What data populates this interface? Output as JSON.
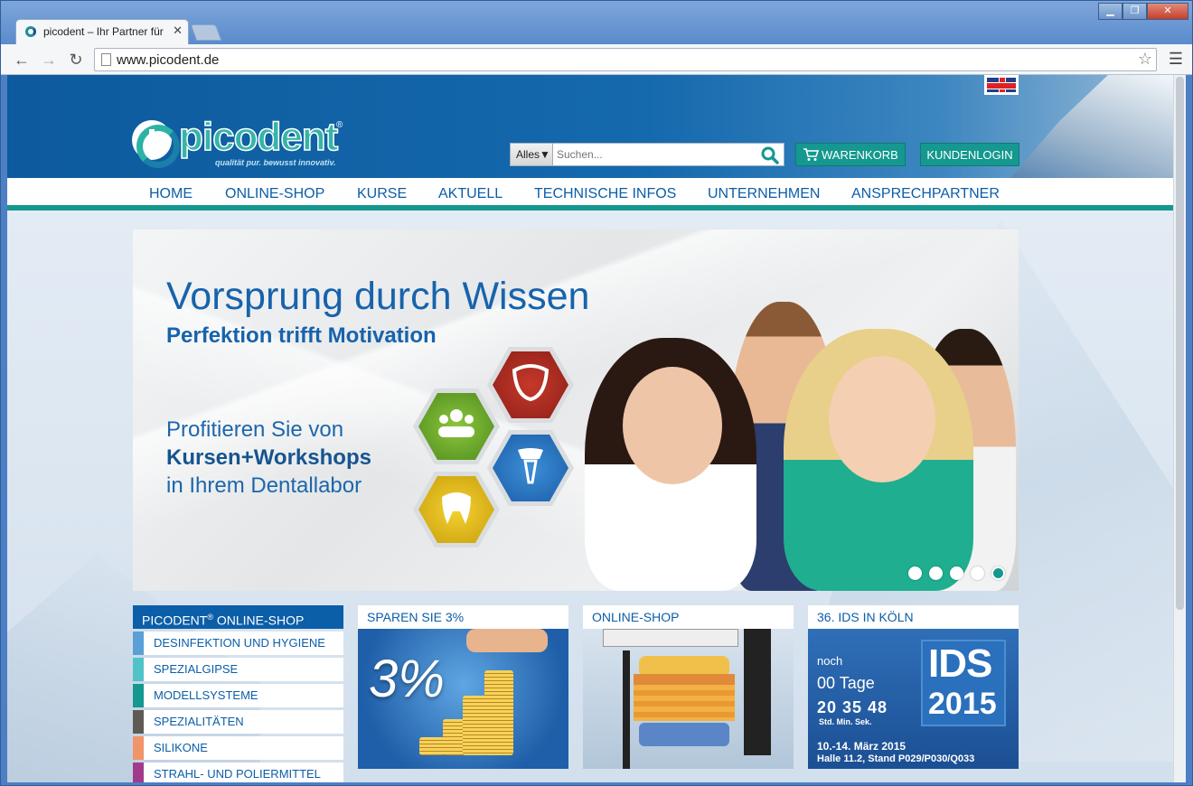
{
  "browser": {
    "tab_title": "picodent – Ihr Partner für",
    "url": "www.picodent.de",
    "minimize": "▁",
    "restore": "❐",
    "close": "✕"
  },
  "header": {
    "logo_text": "picodent",
    "logo_tagline": "qualität pur. bewusst innovativ.",
    "search_scope": "Alles▼",
    "search_placeholder": "Suchen...",
    "cart_label": "WARENKORB",
    "login_label": "KUNDENLOGIN",
    "language_flag": "uk-flag-icon"
  },
  "nav": {
    "items": [
      "HOME",
      "ONLINE-SHOP",
      "KURSE",
      "AKTUELL",
      "TECHNISCHE INFOS",
      "UNTERNEHMEN",
      "ANSPRECHPARTNER"
    ]
  },
  "slider": {
    "headline": "Vorsprung durch Wissen",
    "subheadline": "Perfektion trifft Motivation",
    "line1": "Profitieren Sie von",
    "line2": "Kursen+Workshops",
    "line3": "in Ihrem Dentallabor",
    "slide_count": 5,
    "active_slide": 5
  },
  "shopmenu": {
    "title": "PICODENT",
    "title_sup": "®",
    "title_rest": " ONLINE-SHOP",
    "items": [
      {
        "label": "DESINFEKTION UND HYGIENE",
        "color": "#5a9fd6"
      },
      {
        "label": "SPEZIALGIPSE",
        "color": "#4fc3c7"
      },
      {
        "label": "MODELLSYSTEME",
        "color": "#14988f"
      },
      {
        "label": "SPEZIALITÄTEN",
        "color": "#5f5a55"
      },
      {
        "label": "SILIKONE",
        "color": "#f0956a"
      },
      {
        "label": "STRAHL- UND POLIERMITTEL",
        "color": "#a23a8c"
      }
    ]
  },
  "tiles": {
    "save": {
      "title": "SPAREN SIE 3%",
      "big_text": "3%"
    },
    "shop": {
      "title": "ONLINE-SHOP"
    },
    "ids": {
      "title": "36. IDS IN KÖLN",
      "noch": "noch",
      "days": "00 Tage",
      "time": "20 35 48",
      "units": "Std.  Min.  Sek.",
      "logo_top": "IDS",
      "logo_year": "2015",
      "date": "10.-14. März 2015",
      "place": "Halle 11.2, Stand P029/P030/Q033"
    }
  },
  "colors": {
    "brand_blue": "#0b5ea8",
    "brand_teal": "#14988f"
  }
}
